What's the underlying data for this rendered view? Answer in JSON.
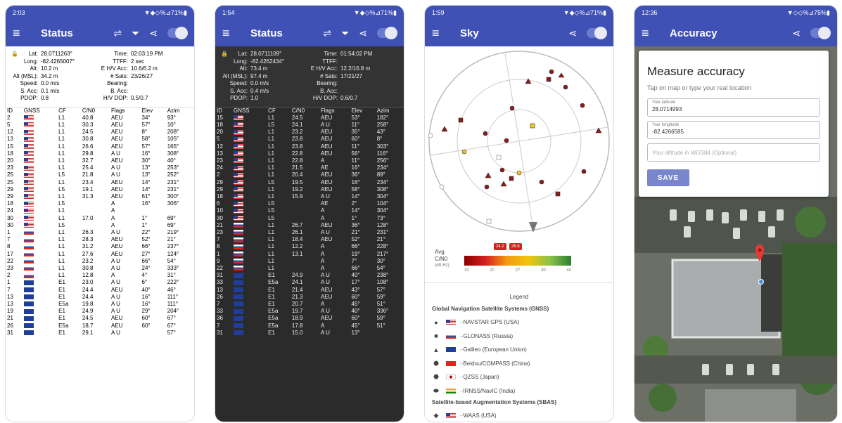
{
  "colors": {
    "primary": "#3F51B5",
    "accent": "#7986cb"
  },
  "screens": [
    {
      "status": {
        "time": "2:03",
        "icons": "▼◆◇%⊿71%▮"
      },
      "title": "Status",
      "info": [
        [
          "Lat:",
          "28.0711263°",
          "Time:",
          "02:03:19 PM"
        ],
        [
          "Long:",
          "-82.4265007°",
          "TTFF:",
          "2 sec"
        ],
        [
          "Alt:",
          "10.2 m",
          "E H/V Acc:",
          "10.6/6.2 m"
        ],
        [
          "Alt (MSL):",
          "34.2 m",
          "# Sats:",
          "23/26/27"
        ],
        [
          "Speed:",
          "0.0 m/s",
          "Bearing:",
          ""
        ],
        [
          "S. Acc:",
          "0.1 m/s",
          "B. Acc:",
          ""
        ],
        [
          "PDOP:",
          "0.8",
          "H/V DOP:",
          "0.5/0.7"
        ]
      ],
      "headers": [
        "ID",
        "GNSS",
        "CF",
        "C/N0",
        "Flags",
        "Elev",
        "Azim"
      ],
      "rows": [
        [
          "2",
          "us",
          "L1",
          "40.8",
          "AEU",
          "34°",
          "93°"
        ],
        [
          "5",
          "us",
          "L1",
          "30.3",
          "AEU",
          "57°",
          "10°"
        ],
        [
          "12",
          "us",
          "L1",
          "24.5",
          "AEU",
          "8°",
          "208°"
        ],
        [
          "13",
          "us",
          "L1",
          "30.8",
          "AEU",
          "58°",
          "105°"
        ],
        [
          "15",
          "us",
          "L1",
          "26.6",
          "AEU",
          "57°",
          "165°"
        ],
        [
          "18",
          "us",
          "L1",
          "29.8",
          "A U",
          "16°",
          "308°"
        ],
        [
          "20",
          "us",
          "L1",
          "32.7",
          "AEU",
          "30°",
          "40°"
        ],
        [
          "23",
          "us",
          "L1",
          "25.4",
          "A U",
          "13°",
          "253°"
        ],
        [
          "25",
          "us",
          "L5",
          "21.8",
          "A U",
          "13°",
          "252°"
        ],
        [
          "25",
          "us",
          "L1",
          "23.4",
          "AEU",
          "14°",
          "231°"
        ],
        [
          "29",
          "us",
          "L5",
          "19.1",
          "AEU",
          "14°",
          "231°"
        ],
        [
          "29",
          "us",
          "L1",
          "31.3",
          "AEU",
          "61°",
          "300°"
        ],
        [
          "18",
          "us",
          "L5",
          "",
          "A",
          "16°",
          "306°"
        ],
        [
          "24",
          "us",
          "L1",
          "",
          "A",
          "",
          ""
        ],
        [
          "30",
          "us",
          "L1",
          "17.0",
          "A",
          "1°",
          "69°"
        ],
        [
          "30",
          "us",
          "L5",
          "",
          "A",
          "1°",
          "69°"
        ],
        [
          "1",
          "ru",
          "L1",
          "26.3",
          "A U",
          "22°",
          "219°"
        ],
        [
          "7",
          "ru",
          "L1",
          "28.3",
          "AEU",
          "52°",
          "21°"
        ],
        [
          "8",
          "ru",
          "L1",
          "31.2",
          "AEU",
          "66°",
          "237°"
        ],
        [
          "17",
          "ru",
          "L1",
          "27.6",
          "AEU",
          "27°",
          "124°"
        ],
        [
          "22",
          "ru",
          "L1",
          "23.2",
          "A U",
          "66°",
          "54°"
        ],
        [
          "23",
          "ru",
          "L1",
          "30.8",
          "A U",
          "24°",
          "333°"
        ],
        [
          "2",
          "ru",
          "L1",
          "12.8",
          "A",
          "4°",
          "31°"
        ],
        [
          "1",
          "eu",
          "E1",
          "23.0",
          "A U",
          "6°",
          "222°"
        ],
        [
          "7",
          "eu",
          "E1",
          "24.4",
          "AEU",
          "40°",
          "46°"
        ],
        [
          "13",
          "eu",
          "E1",
          "24.4",
          "A U",
          "16°",
          "111°"
        ],
        [
          "13",
          "eu",
          "E5a",
          "19.8",
          "A U",
          "16°",
          "111°"
        ],
        [
          "19",
          "eu",
          "E1",
          "24.9",
          "A U",
          "29°",
          "204°"
        ],
        [
          "21",
          "eu",
          "E1",
          "24.5",
          "AEU",
          "60°",
          "67°"
        ],
        [
          "26",
          "eu",
          "E5a",
          "18.7",
          "AEU",
          "60°",
          "67°"
        ],
        [
          "31",
          "eu",
          "E1",
          "29.1",
          "A U",
          "",
          "57°"
        ]
      ]
    },
    {
      "status": {
        "time": "1:54",
        "icons": "▼◆◇%⊿71%▮"
      },
      "title": "Status",
      "info": [
        [
          "Lat:",
          "28.0711109°",
          "Time:",
          "01:54:02 PM"
        ],
        [
          "Long:",
          "-82.4262434°",
          "TTFF:",
          ""
        ],
        [
          "Alt:",
          "73.4 m",
          "E H/V Acc:",
          "12.2/16.8 m"
        ],
        [
          "Alt (MSL):",
          "97.4 m",
          "# Sats:",
          "17/21/27"
        ],
        [
          "Speed:",
          "0.0 m/s",
          "Bearing:",
          ""
        ],
        [
          "S. Acc:",
          "0.4 m/s",
          "B. Acc:",
          ""
        ],
        [
          "PDOP:",
          "1.0",
          "H/V DOP:",
          "0.6/0.7"
        ]
      ],
      "headers": [
        "ID",
        "GNSS",
        "CF",
        "C/N0",
        "Flags",
        "Elev",
        "Azim"
      ],
      "rows": [
        [
          "15",
          "us",
          "L1",
          "24.5",
          "AEU",
          "53°",
          "182°"
        ],
        [
          "18",
          "us",
          "L5",
          "24.1",
          "A U",
          "11°",
          "258°"
        ],
        [
          "20",
          "us",
          "L1",
          "23.2",
          "AEU",
          "35°",
          "43°"
        ],
        [
          "5",
          "us",
          "L1",
          "23.8",
          "AEU",
          "60°",
          "8°"
        ],
        [
          "12",
          "us",
          "L1",
          "23.8",
          "AEU",
          "11°",
          "303°"
        ],
        [
          "13",
          "us",
          "L1",
          "22.8",
          "AEU",
          "56°",
          "116°"
        ],
        [
          "23",
          "us",
          "L1",
          "22.8",
          "A",
          "11°",
          "256°"
        ],
        [
          "24",
          "us",
          "L1",
          "21.5",
          "AE",
          "16°",
          "234°"
        ],
        [
          "2",
          "us",
          "L1",
          "20.4",
          "AEU",
          "36°",
          "89°"
        ],
        [
          "29",
          "us",
          "L5",
          "19.5",
          "AEU",
          "16°",
          "234°"
        ],
        [
          "29",
          "us",
          "L1",
          "19.2",
          "AEU",
          "58°",
          "308°"
        ],
        [
          "18",
          "us",
          "L1",
          "15.9",
          "A U",
          "14°",
          "304°"
        ],
        [
          "6",
          "us",
          "L5",
          "",
          "AE",
          "2°",
          "104°"
        ],
        [
          "10",
          "us",
          "L5",
          "",
          "A",
          "14°",
          "304°"
        ],
        [
          "30",
          "us",
          "L5",
          "",
          "A",
          "1°",
          "73°"
        ],
        [
          "21",
          "ru",
          "L1",
          "26.7",
          "AEU",
          "36°",
          "128°"
        ],
        [
          "23",
          "ru",
          "L1",
          "26.1",
          "A U",
          "21°",
          "231°"
        ],
        [
          "7",
          "ru",
          "L1",
          "18.4",
          "AEU",
          "52°",
          "21°"
        ],
        [
          "8",
          "ru",
          "L1",
          "12.2",
          "A",
          "66°",
          "228°"
        ],
        [
          "1",
          "ru",
          "L1",
          "13.1",
          "A",
          "19°",
          "217°"
        ],
        [
          "9",
          "ru",
          "L1",
          "",
          "A",
          "7°",
          "30°"
        ],
        [
          "22",
          "ru",
          "L1",
          "",
          "A",
          "66°",
          "54°"
        ],
        [
          "31",
          "eu",
          "E1",
          "24.9",
          "A U",
          "40°",
          "238°"
        ],
        [
          "33",
          "eu",
          "E5a",
          "24.1",
          "A U",
          "17°",
          "108°"
        ],
        [
          "13",
          "eu",
          "E1",
          "21.4",
          "AEU",
          "43°",
          "57°"
        ],
        [
          "26",
          "eu",
          "E1",
          "21.3",
          "AEU",
          "60°",
          "59°"
        ],
        [
          "7",
          "eu",
          "E1",
          "20.7",
          "A",
          "45°",
          "51°"
        ],
        [
          "33",
          "eu",
          "E5a",
          "19.7",
          "A U",
          "40°",
          "336°"
        ],
        [
          "36",
          "eu",
          "E5a",
          "18.9",
          "AEU",
          "60°",
          "59°"
        ],
        [
          "7",
          "eu",
          "E5a",
          "17.8",
          "A",
          "45°",
          "51°"
        ],
        [
          "31",
          "eu",
          "E1",
          "15.0",
          "A U",
          "13°",
          ""
        ]
      ]
    },
    {
      "status": {
        "time": "1:59",
        "icons": "▼◆◇%⊿71%▮"
      },
      "title": "Sky",
      "avg_label": "Avg\nC/N0",
      "avg_unit": "(dB-Hz)",
      "cn0_markers": [
        "24.2",
        "26.8"
      ],
      "cn0_ticks": [
        "10",
        "20",
        "27",
        "30",
        "40"
      ],
      "legend_title": "Legend",
      "gnss_section": "Global Navigation Satellite Systems (GNSS)",
      "gnss": [
        {
          "sym": "●",
          "flag": "us",
          "label": "NAVSTAR GPS (USA)"
        },
        {
          "sym": "■",
          "flag": "ru",
          "label": "GLONASS (Russia)"
        },
        {
          "sym": "▲",
          "flag": "eu",
          "label": "Galileo (European Union)"
        },
        {
          "sym": "⬢",
          "flag": "cn",
          "label": "Beidou/COMPASS (China)"
        },
        {
          "sym": "⬣",
          "flag": "jp",
          "label": "QZSS (Japan)"
        },
        {
          "sym": "⬬",
          "flag": "in",
          "label": "IRNSS/NavIC (India)"
        }
      ],
      "sbas_section": "Satellite-based Augmentation Systems (SBAS)",
      "sbas": [
        {
          "sym": "◆",
          "flag": "us",
          "label": "WAAS (USA)"
        }
      ]
    },
    {
      "status": {
        "time": "12:36",
        "icons": "▼◇◇%⊿75%▮"
      },
      "title": "Accuracy",
      "card": {
        "heading": "Measure accuracy",
        "sub": "Tap on map or type your real location",
        "lat_label": "Your latitude",
        "lat_value": "28.0714993",
        "lon_label": "Your longitude",
        "lon_value": "-82.4266585",
        "alt_placeholder": "Your altitude in WGS84 (Optional)",
        "save": "SAVE"
      }
    }
  ]
}
